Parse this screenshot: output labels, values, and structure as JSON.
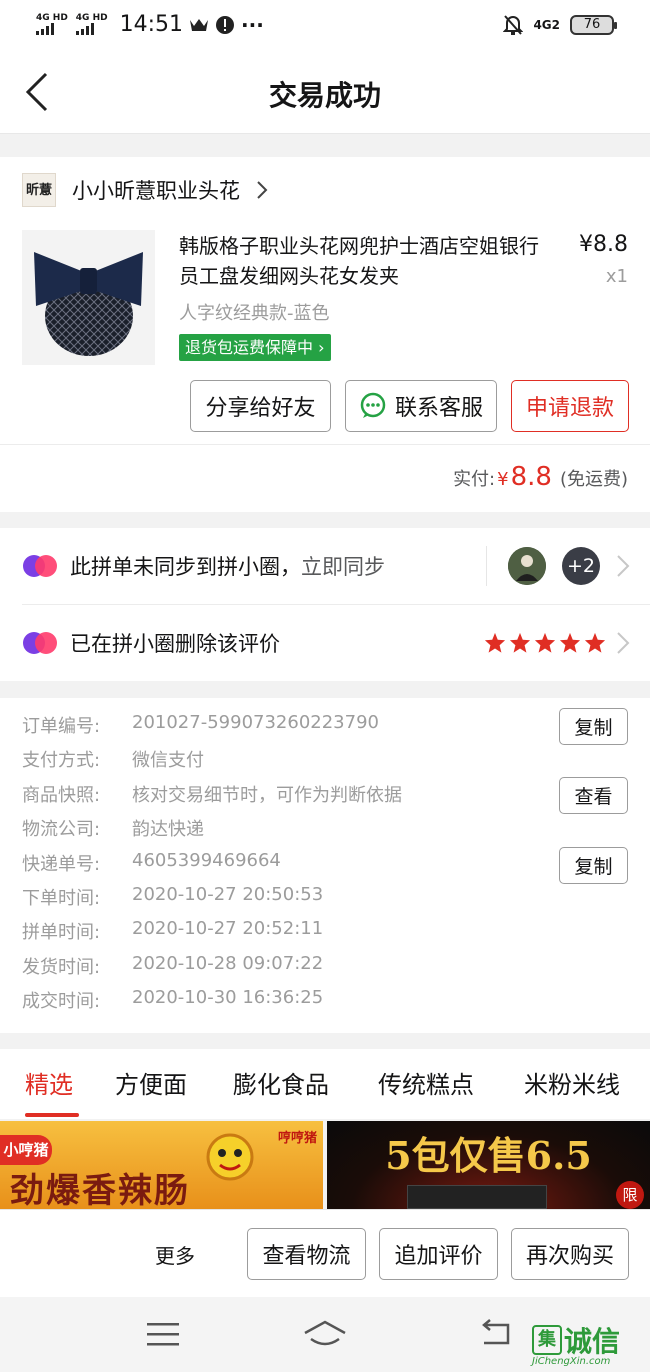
{
  "status_bar": {
    "net1": "4G HD",
    "net2": "4G HD",
    "time": "14:51",
    "net_right": "4G2",
    "battery": "76"
  },
  "nav": {
    "title": "交易成功"
  },
  "shop": {
    "logo_text": "昕薏",
    "name": "小小昕薏职业头花",
    "product": {
      "name": "韩版格子职业头花网兜护士酒店空姐银行员工盘发细网头花女发夹",
      "price": "¥8.8",
      "qty": "x1",
      "spec": "人字纹经典款-蓝色",
      "guarantee": "退货包运费保障中"
    },
    "buttons": {
      "share": "分享给好友",
      "contact": "联系客服",
      "refund": "申请退款"
    },
    "paid_label": "实付:",
    "paid_currency": "¥",
    "paid_amount": "8.8",
    "paid_note": "(免运费)"
  },
  "pxq": {
    "row1_text": "此拼单未同步到拼小圈，",
    "row1_action": "立即同步",
    "avatar_more": "+2",
    "row2_text": "已在拼小圈删除该评价",
    "rating": 5
  },
  "order_info": {
    "rows": [
      {
        "k": "订单编号:",
        "v": "201027-599073260223790"
      },
      {
        "k": "支付方式:",
        "v": "微信支付"
      },
      {
        "k": "商品快照:",
        "v": "核对交易细节时，可作为判断依据"
      },
      {
        "k": "物流公司:",
        "v": "韵达快递"
      },
      {
        "k": "快递单号:",
        "v": "4605399469664"
      },
      {
        "k": "下单时间:",
        "v": "2020-10-27 20:50:53"
      },
      {
        "k": "拼单时间:",
        "v": "2020-10-27 20:52:11"
      },
      {
        "k": "发货时间:",
        "v": "2020-10-28 09:07:22"
      },
      {
        "k": "成交时间:",
        "v": "2020-10-30 16:36:25"
      }
    ],
    "copy1": "复制",
    "view": "查看",
    "copy2": "复制"
  },
  "tabs": [
    "精选",
    "方便面",
    "膨化食品",
    "传统糕点",
    "米粉米线"
  ],
  "banners": {
    "left_brand": "小哼猪",
    "left_text": "劲爆香辣肠",
    "left_corner": "哼哼猪",
    "right_text": "5包仅售6.5",
    "right_badge": "限"
  },
  "bottom_bar": {
    "more": "更多",
    "logistics": "查看物流",
    "review": "追加评价",
    "rebuy": "再次购买"
  },
  "watermark": {
    "logo_box": "集",
    "logo_text": "诚信",
    "url": "JiChengXin.com"
  },
  "colors": {
    "accent_red": "#e02e24",
    "guarantee_green": "#25a244",
    "text": "#151516",
    "secondary": "#9c9c9c"
  }
}
